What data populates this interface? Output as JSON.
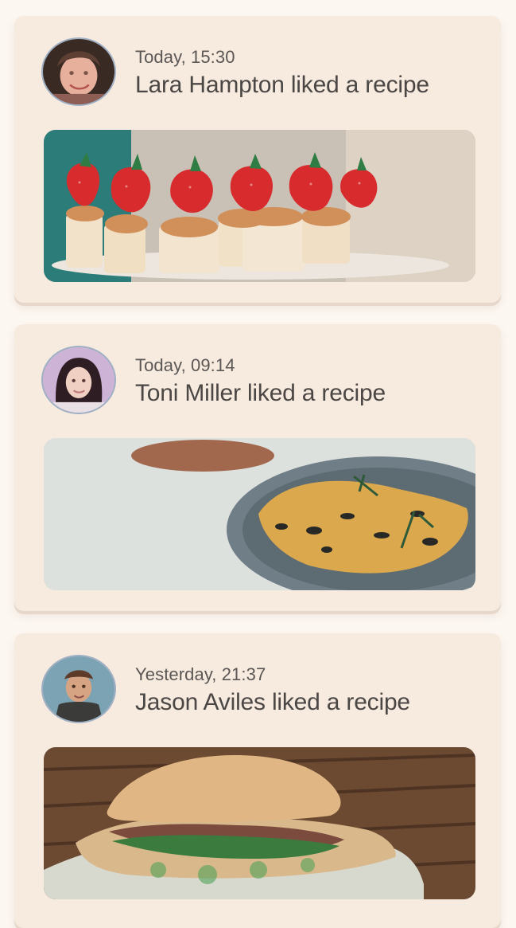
{
  "feed": {
    "items": [
      {
        "time": "Today, 15:30",
        "title": "Lara Hampton liked a recipe"
      },
      {
        "time": "Today, 09:14",
        "title": "Toni Miller liked a recipe"
      },
      {
        "time": "Yesterday, 21:37",
        "title": "Jason Aviles liked a recipe"
      }
    ]
  }
}
